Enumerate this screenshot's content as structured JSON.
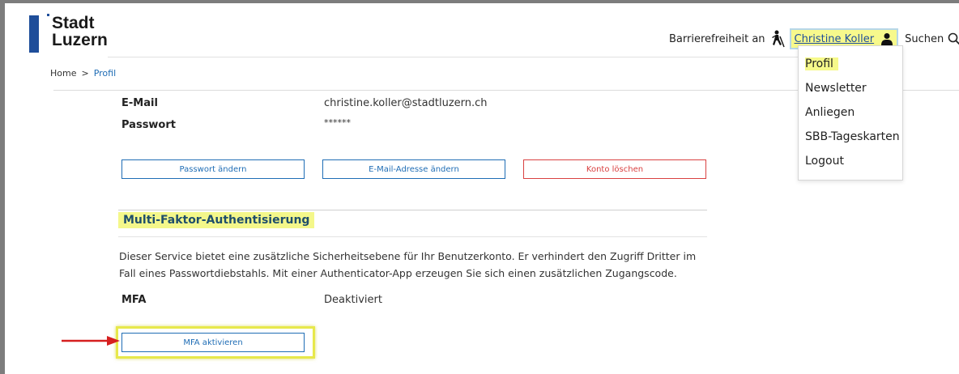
{
  "logo": {
    "line1": "Stadt",
    "line2": "Luzern"
  },
  "nav": {
    "accessibility_label": "Barrierefreiheit an",
    "user_name": "Christine Koller",
    "search_label": "Suchen"
  },
  "breadcrumb": {
    "home": "Home",
    "separator": ">",
    "current": "Profil"
  },
  "dropdown": {
    "items": [
      "Profil",
      "Newsletter",
      "Anliegen",
      "SBB-Tageskarten",
      "Logout"
    ]
  },
  "profile": {
    "email_label": "E-Mail",
    "email_value": "christine.koller@stadtluzern.ch",
    "password_label": "Passwort",
    "password_value": "******"
  },
  "buttons": {
    "change_password": "Passwort ändern",
    "change_email": "E-Mail-Adresse ändern",
    "delete_account": "Konto löschen"
  },
  "mfa": {
    "heading": "Multi-Faktor-Authentisierung",
    "description": "Dieser Service bietet eine zusätzliche Sicherheitsebene für Ihr Benutzerkonto. Er verhindert den Zugriff Dritter im Fall eines Passwortdiebstahls. Mit einer Authenticator-App erzeugen Sie sich einen zusätzlichen Zugangscode.",
    "label": "MFA",
    "status": "Deaktiviert",
    "activate_button": "MFA aktivieren"
  },
  "colors": {
    "brand_blue": "#1f4e9a",
    "link_blue": "#1f6db5",
    "danger_red": "#d94141",
    "highlight_yellow": "#f4f78a",
    "arrow_red": "#d62020"
  },
  "icons": [
    "accessibility-icon",
    "person-icon",
    "search-icon",
    "arrow-icon"
  ]
}
